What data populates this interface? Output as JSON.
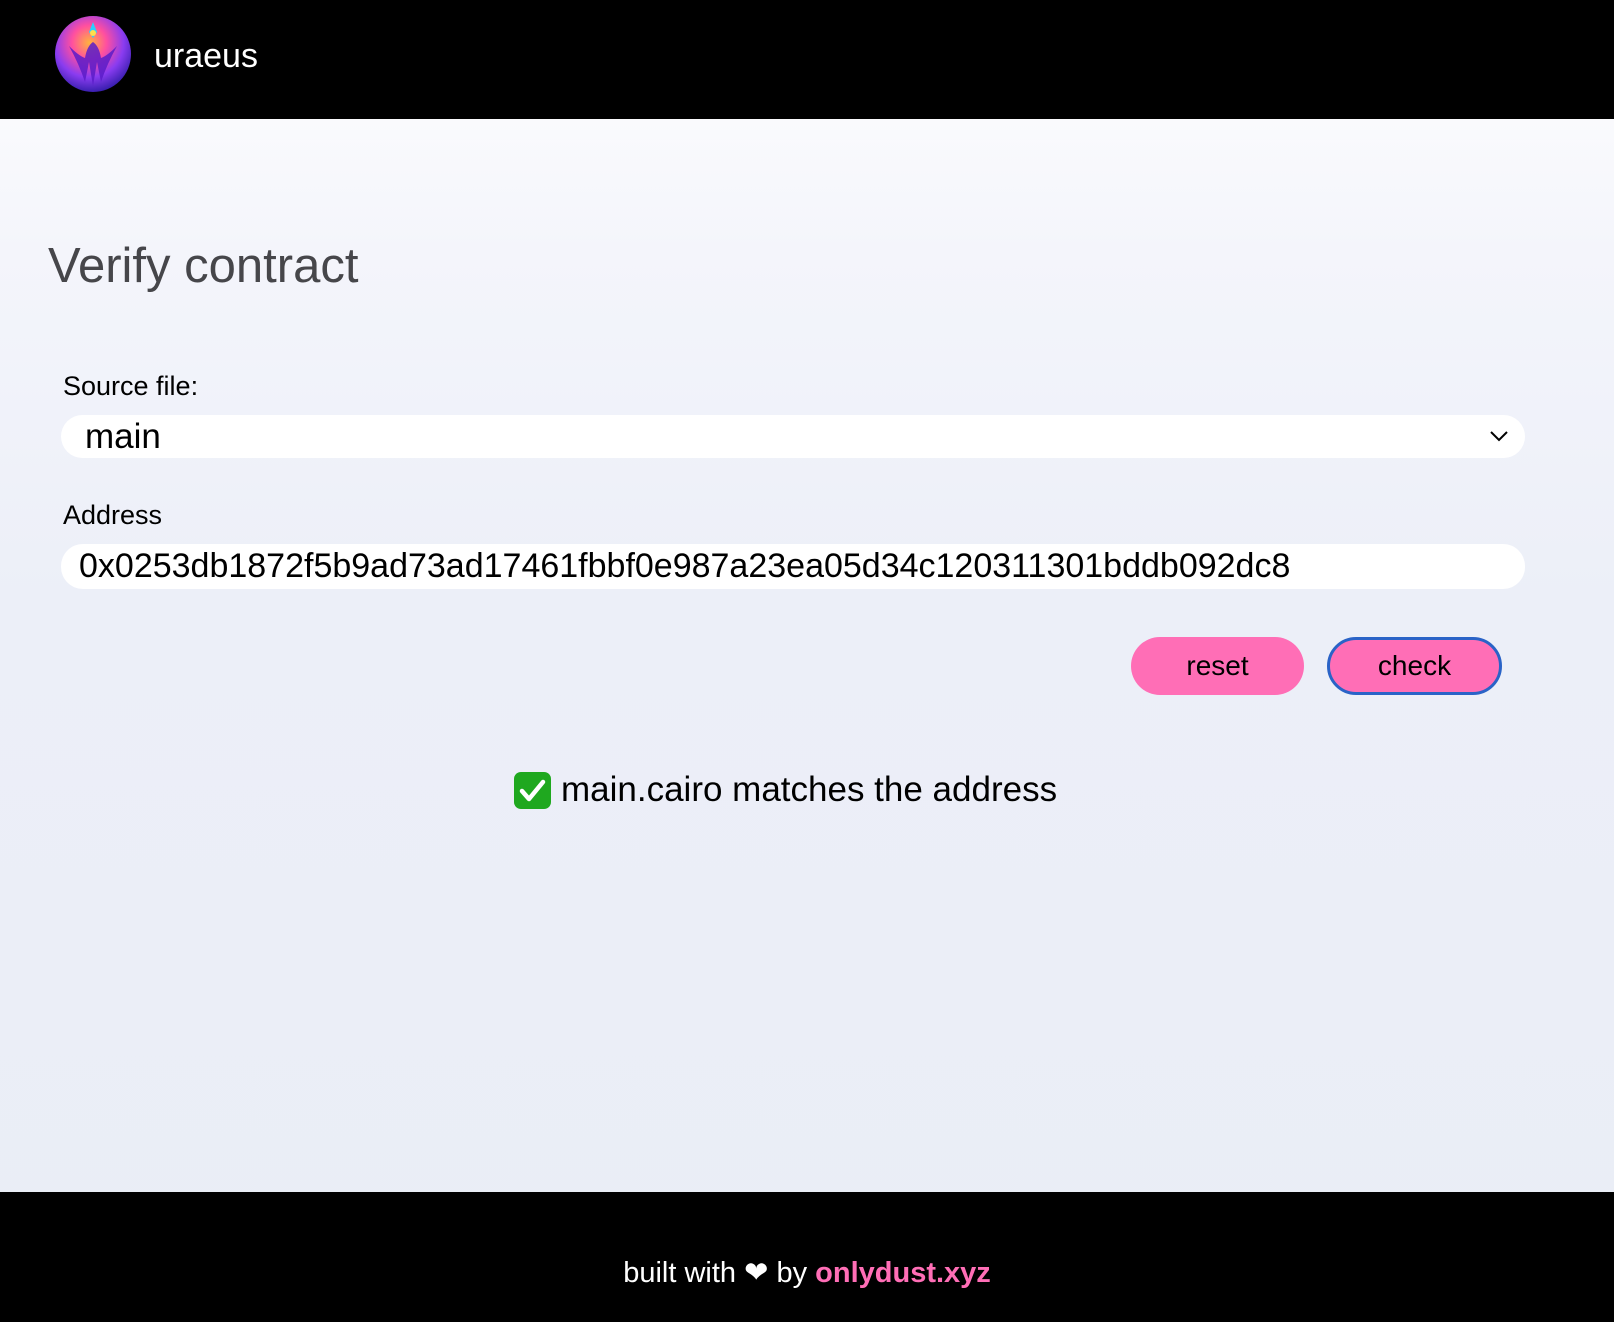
{
  "header": {
    "app_name": "uraeus",
    "logo_icon": "uraeus-logo-icon"
  },
  "main": {
    "title": "Verify contract",
    "source_label": "Source file:",
    "source_value": "main",
    "address_label": "Address",
    "address_value": "0x0253db1872f5b9ad73ad17461fbbf0e987a23ea05d34c120311301bddb092dc8",
    "reset_label": "reset",
    "check_label": "check",
    "result_icon": "check-mark-icon",
    "result_text": "main.cairo matches the address"
  },
  "footer": {
    "prefix": "built with",
    "heart": "❤",
    "by": "by",
    "link_text": "onlydust.xyz"
  },
  "colors": {
    "accent_pink": "#ff6eb6",
    "focus_blue": "#2a63c7",
    "bar_black": "#000000",
    "success_green": "#1fa81f"
  }
}
